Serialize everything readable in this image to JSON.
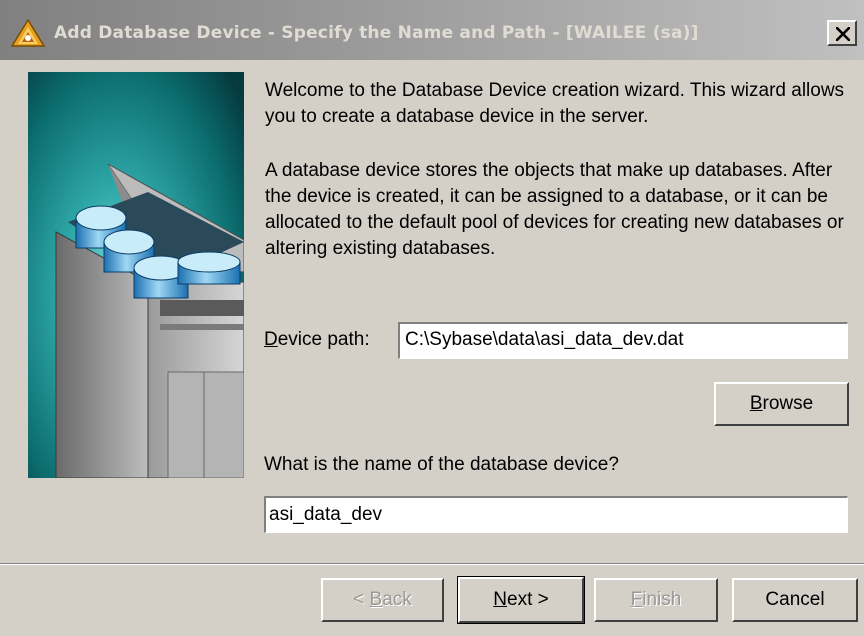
{
  "window": {
    "title": "Add Database Device - Specify the Name and Path - [WAILEE (sa)]",
    "close_glyph": "×"
  },
  "wizard": {
    "intro": "Welcome to the Database Device creation wizard. This wizard allows you to create a database device in the server.",
    "description": "A database device stores the objects that make up databases. After the device is created, it can be assigned to a database, or it can be allocated to the default pool of devices for creating new databases or altering existing databases.",
    "device_path": {
      "label_mnemonic": "D",
      "label_rest": "evice path:",
      "value": "C:\\Sybase\\data\\asi_data_dev.dat"
    },
    "browse": {
      "mnemonic": "B",
      "rest": "rowse"
    },
    "name_question": "What is the name of the database device?",
    "name_value": "asi_data_dev"
  },
  "footer": {
    "back": {
      "prefix": "< ",
      "mnemonic": "B",
      "rest": "ack",
      "enabled": false
    },
    "next": {
      "mnemonic": "N",
      "rest": "ext >",
      "enabled": true
    },
    "finish": {
      "mnemonic": "F",
      "rest": "inish",
      "enabled": false
    },
    "cancel": {
      "label": "Cancel",
      "enabled": true
    }
  },
  "icons": {
    "app": "sybase-central-icon",
    "close": "close-icon",
    "art": "database-server-illustration"
  },
  "colors": {
    "dialog_bg": "#d4d0c8",
    "title_gradient_start": "#808080",
    "title_gradient_end": "#c0c0c0",
    "title_text": "#e0dcd4",
    "art_teal": "#0e6e6e",
    "disabled_text": "#9a9894"
  }
}
